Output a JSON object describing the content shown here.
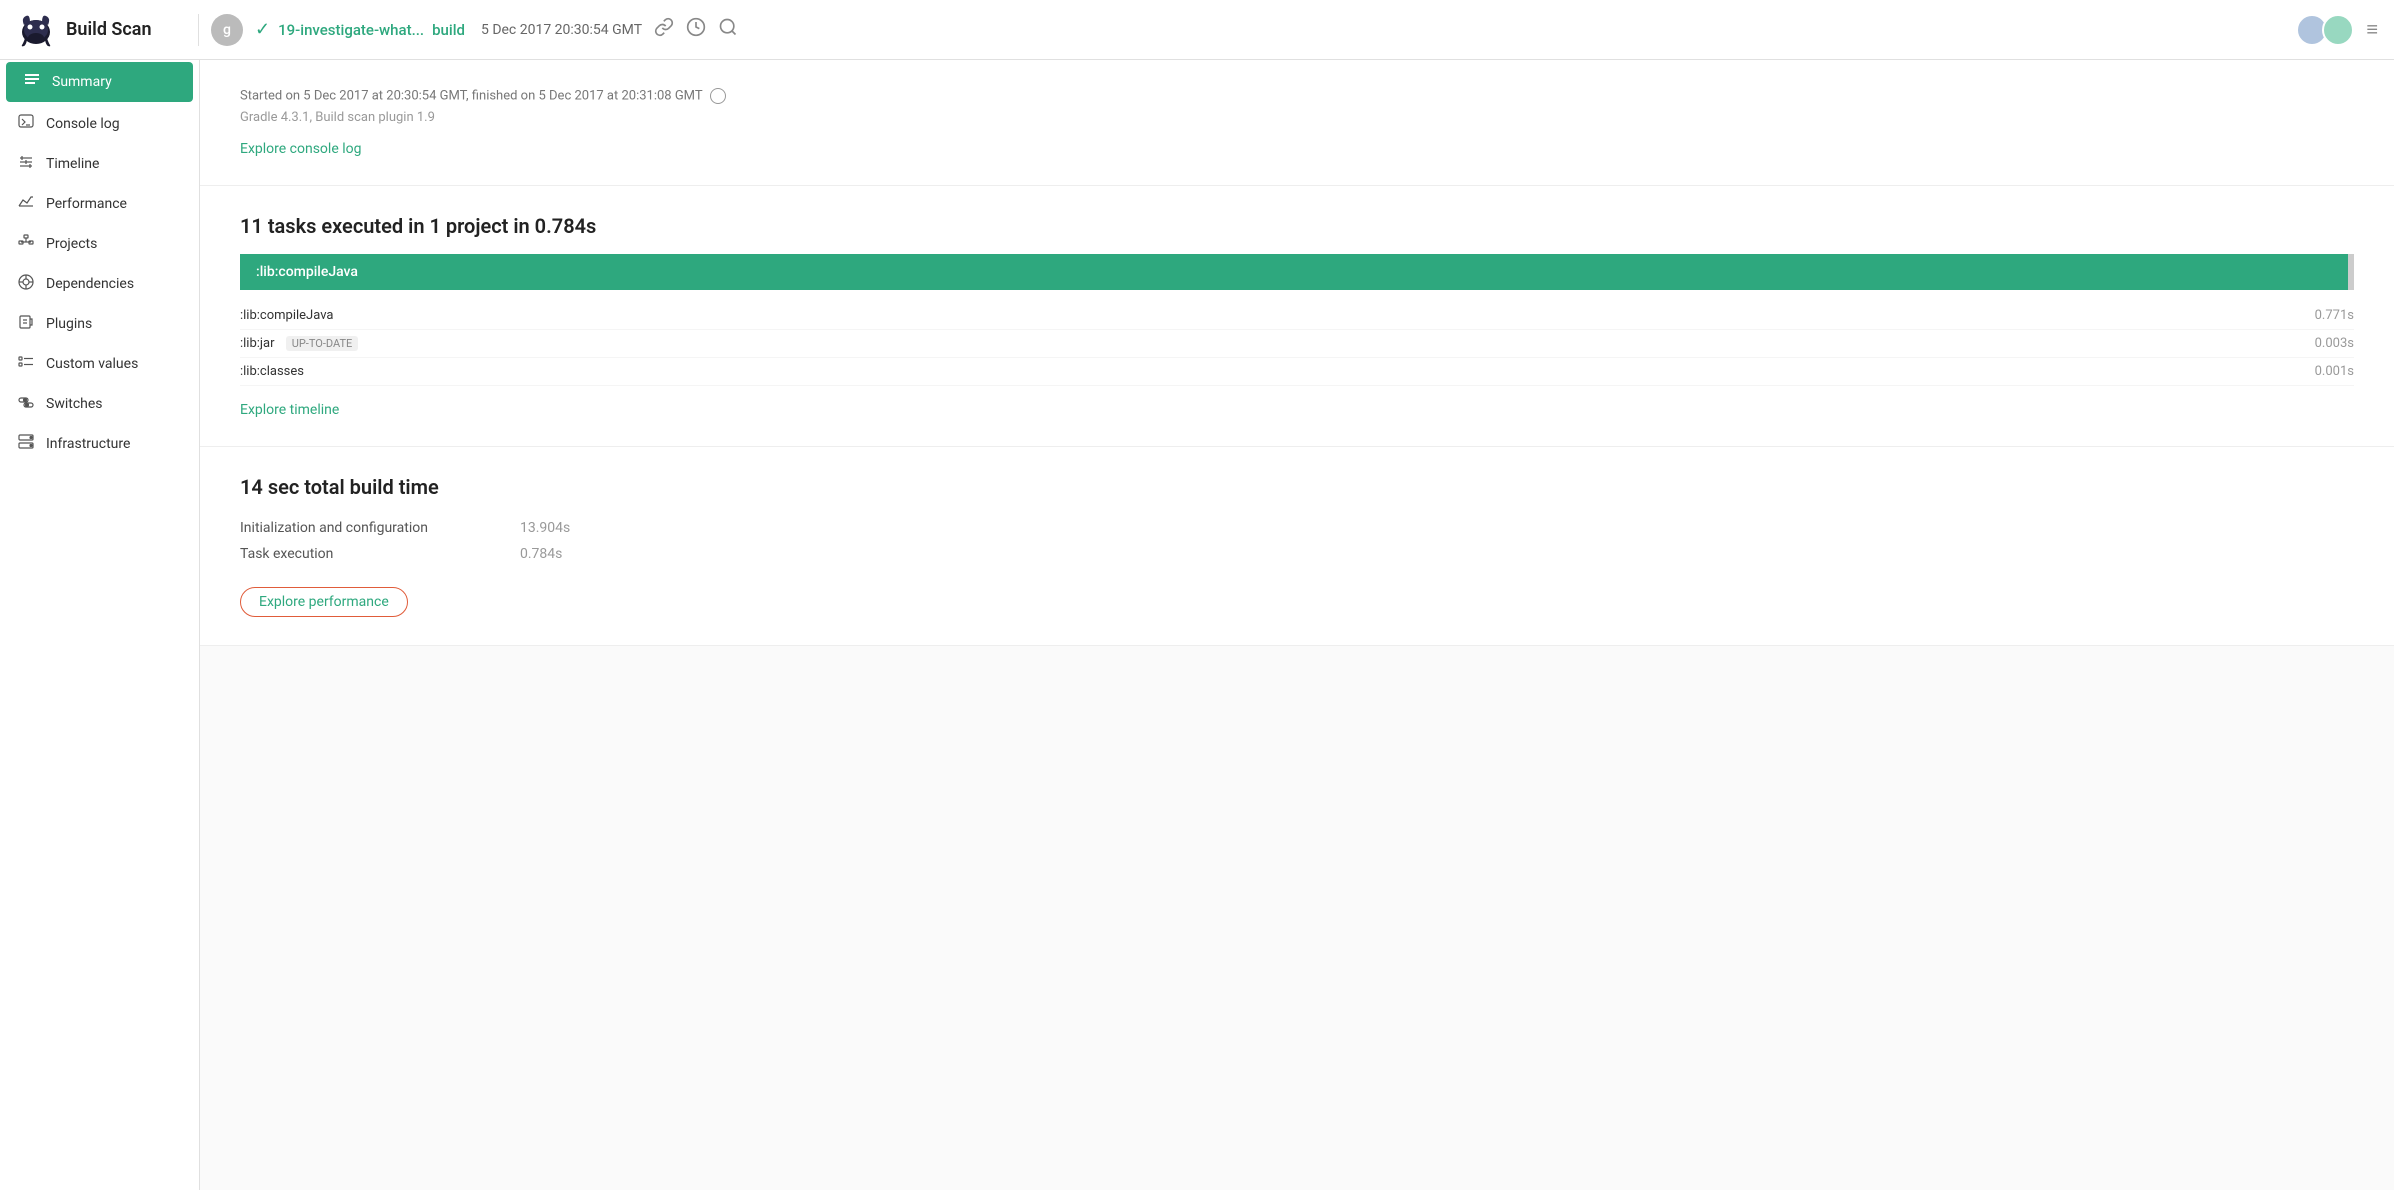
{
  "header": {
    "app_title": "Build Scan",
    "avatar_letter": "g",
    "branch": "19-investigate-what...",
    "build": "build",
    "timestamp": "5 Dec 2017 20:30:54 GMT",
    "link_icon": "🔗",
    "history_icon": "⏱",
    "search_icon": "🔍",
    "hamburger_icon": "≡"
  },
  "sidebar": {
    "items": [
      {
        "id": "summary",
        "label": "Summary",
        "icon": "☰",
        "active": true
      },
      {
        "id": "console-log",
        "label": "Console log",
        "icon": "▶",
        "active": false
      },
      {
        "id": "timeline",
        "label": "Timeline",
        "icon": "⊞",
        "active": false
      },
      {
        "id": "performance",
        "label": "Performance",
        "icon": "📊",
        "active": false
      },
      {
        "id": "projects",
        "label": "Projects",
        "icon": "⊟",
        "active": false
      },
      {
        "id": "dependencies",
        "label": "Dependencies",
        "icon": "⊗",
        "active": false
      },
      {
        "id": "plugins",
        "label": "Plugins",
        "icon": "☐",
        "active": false
      },
      {
        "id": "custom-values",
        "label": "Custom values",
        "icon": "≡",
        "active": false
      },
      {
        "id": "switches",
        "label": "Switches",
        "icon": "⊙",
        "active": false
      },
      {
        "id": "infrastructure",
        "label": "Infrastructure",
        "icon": "⊞",
        "active": false
      }
    ]
  },
  "main": {
    "build_info": {
      "started": "Started on 5 Dec 2017 at 20:30:54 GMT, finished on 5 Dec 2017 at 20:31:08 GMT",
      "gradle_version": "Gradle 4.3.1,  Build scan plugin 1.9",
      "explore_console_log": "Explore console log"
    },
    "tasks": {
      "header": "11 tasks executed in 1 project in 0.784s",
      "highlighted_task": ":lib:compileJava",
      "task_list": [
        {
          "name": ":lib:compileJava",
          "badge": "",
          "time": "0.771s"
        },
        {
          "name": ":lib:jar",
          "badge": "UP-TO-DATE",
          "time": "0.003s"
        },
        {
          "name": ":lib:classes",
          "badge": "",
          "time": "0.001s"
        }
      ],
      "explore_timeline": "Explore timeline"
    },
    "performance": {
      "header": "14 sec total build time",
      "rows": [
        {
          "label": "Initialization and configuration",
          "value": "13.904s"
        },
        {
          "label": "Task execution",
          "value": "0.784s"
        }
      ],
      "explore_performance": "Explore performance"
    }
  }
}
